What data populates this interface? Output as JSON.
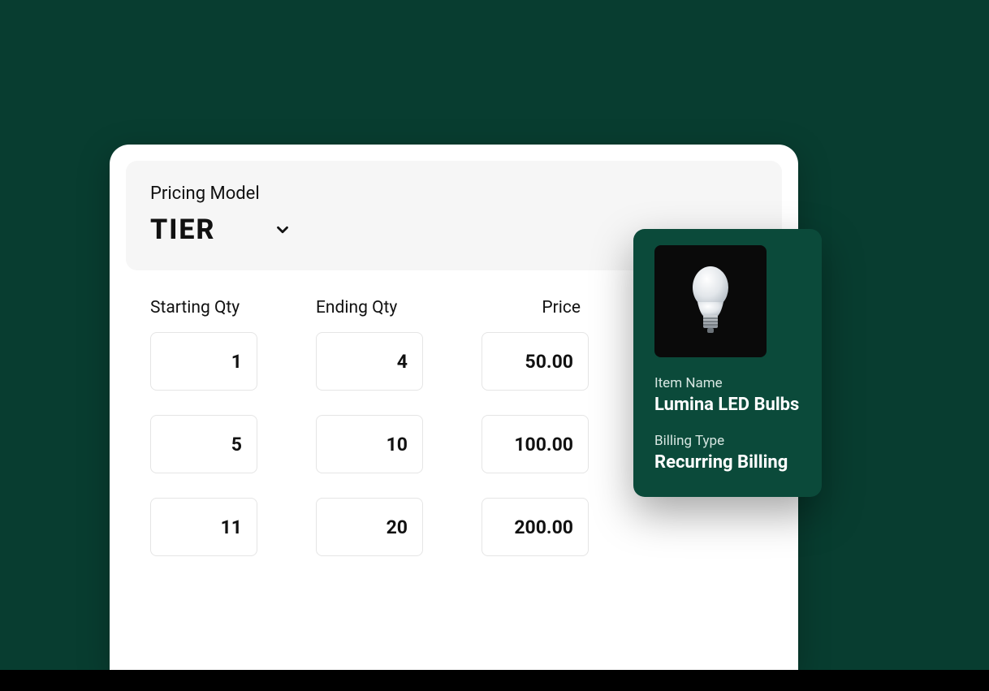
{
  "pricing": {
    "label": "Pricing Model",
    "value": "TIER"
  },
  "columns": {
    "start": "Starting Qty",
    "end": "Ending Qty",
    "price": "Price"
  },
  "tiers": [
    {
      "start": "1",
      "end": "4",
      "price": "50.00"
    },
    {
      "start": "5",
      "end": "10",
      "price": "100.00"
    },
    {
      "start": "11",
      "end": "20",
      "price": "200.00"
    }
  ],
  "item": {
    "name_label": "Item Name",
    "name_value": "Lumina LED Bulbs",
    "billing_label": "Billing Type",
    "billing_value": "Recurring Billing"
  }
}
